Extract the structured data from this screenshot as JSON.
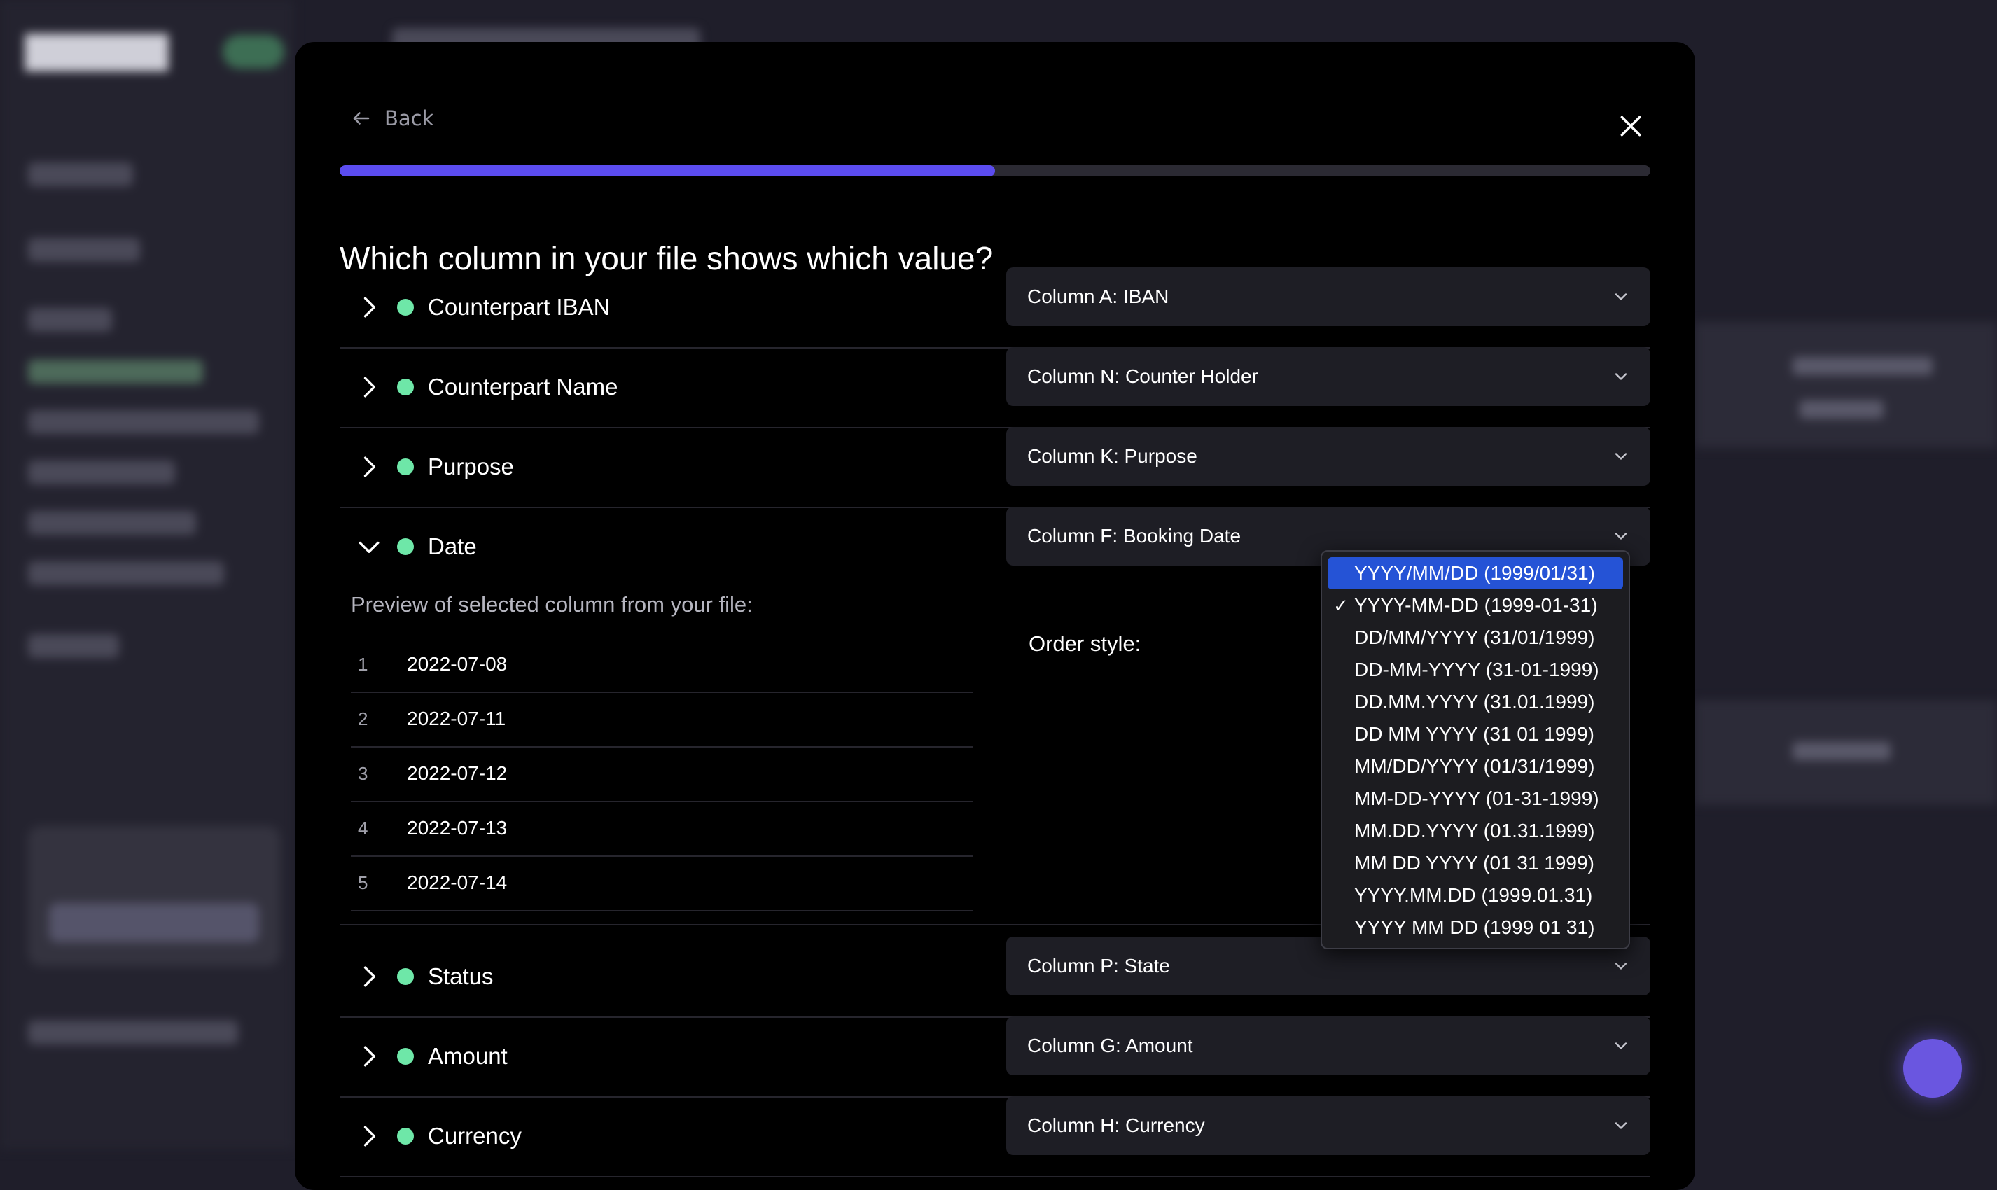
{
  "modal": {
    "back_label": "Back",
    "title": "Which column in your file shows which value?",
    "progress": 0.5
  },
  "fields": [
    {
      "label": "Counterpart IBAN",
      "column": "Column A: IBAN",
      "expanded": false
    },
    {
      "label": "Counterpart Name",
      "column": "Column N: Counter Holder",
      "expanded": false
    },
    {
      "label": "Purpose",
      "column": "Column K: Purpose",
      "expanded": false
    },
    {
      "label": "Date",
      "column": "Column F: Booking Date",
      "expanded": true
    },
    {
      "label": "Status",
      "column": "Column P: State",
      "expanded": false
    },
    {
      "label": "Amount",
      "column": "Column G: Amount",
      "expanded": false
    },
    {
      "label": "Currency",
      "column": "Column H: Currency",
      "expanded": false
    }
  ],
  "date_detail": {
    "preview_title": "Preview of selected column from your file:",
    "preview_rows": [
      {
        "index": "1",
        "value": "2022-07-08"
      },
      {
        "index": "2",
        "value": "2022-07-11"
      },
      {
        "index": "3",
        "value": "2022-07-12"
      },
      {
        "index": "4",
        "value": "2022-07-13"
      },
      {
        "index": "5",
        "value": "2022-07-14"
      }
    ],
    "order_label": "Order style:"
  },
  "order_dropdown": {
    "highlighted": "YYYY/MM/DD (1999/01/31)",
    "selected": "YYYY-MM-DD (1999-01-31)",
    "options": [
      "YYYY/MM/DD (1999/01/31)",
      "YYYY-MM-DD (1999-01-31)",
      "DD/MM/YYYY (31/01/1999)",
      "DD-MM-YYYY (31-01-1999)",
      "DD.MM.YYYY (31.01.1999)",
      "DD MM YYYY (31 01 1999)",
      "MM/DD/YYYY (01/31/1999)",
      "MM-DD-YYYY (01-31-1999)",
      "MM.DD.YYYY (01.31.1999)",
      "MM DD YYYY (01 31 1999)",
      "YYYY.MM.DD (1999.01.31)",
      "YYYY MM DD (1999 01 31)"
    ]
  },
  "colors": {
    "accent": "#5b4cf0",
    "status_ok": "#6ee7a8",
    "dropdown_highlight": "#2553d6",
    "modal_bg": "#000000",
    "select_bg": "#1e1e25"
  },
  "icons": {
    "back": "arrow-left-icon",
    "close": "close-icon",
    "collapsed": "chevron-right-icon",
    "expanded": "chevron-down-icon",
    "select_caret": "chevron-down-icon",
    "selected_mark": "checkmark-icon"
  }
}
